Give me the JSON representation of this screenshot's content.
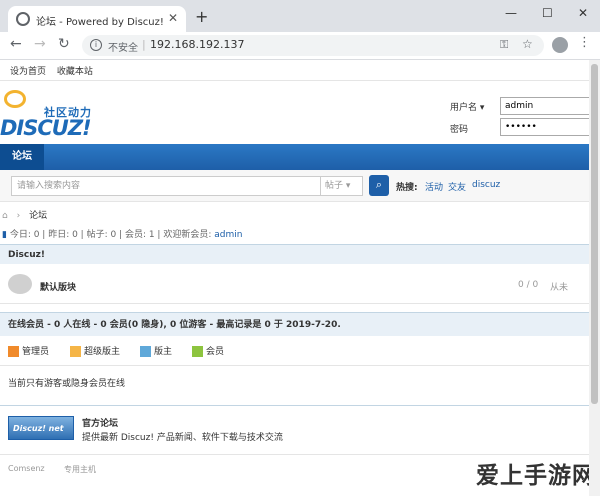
{
  "browser": {
    "tab_title": "论坛 - Powered by Discuz!",
    "tab_close": "✕",
    "new_tab": "+",
    "window_controls": {
      "minimize": "—",
      "maximize": "☐",
      "close": "✕"
    },
    "nav": {
      "back": "←",
      "forward": "→",
      "reload": "↻"
    },
    "omnibox": {
      "info_icon": "i",
      "insecure": "不安全",
      "separator": "|",
      "url": "192.168.192.137"
    },
    "key_icon": "⚿",
    "star_icon": "☆",
    "menu_icon": "⋮"
  },
  "topnav": {
    "items": [
      "设为首页",
      "收藏本站"
    ]
  },
  "logo": {
    "sub": "社区动力",
    "main": "DISCUZ!"
  },
  "login": {
    "username_label": "用户名 ▾",
    "username_value": "admin",
    "password_label": "密码",
    "password_value": "••••••"
  },
  "mainnav": {
    "active": "论坛"
  },
  "search": {
    "placeholder": "请输入搜索内容",
    "select": "帖子 ▾",
    "button_icon": "⌕",
    "hot_label": "热搜:",
    "hot_links": [
      "活动",
      "交友",
      "discuz"
    ]
  },
  "breadcrumb": {
    "home_icon": "⌂",
    "sep": "›",
    "current": "论坛"
  },
  "stats": {
    "icon": "▮",
    "text": "今日: 0 | 昨日: 0 | 帖子: 0 | 会员: 1 | 欢迎新会员: ",
    "new_member": "admin"
  },
  "category": {
    "title": "Discuz!"
  },
  "forum": {
    "name": "默认版块",
    "count": "0 / 0",
    "last": "从未"
  },
  "online": {
    "title": "在线会员 - 0 人在线 - 0 会员(0 隐身), 0 位游客 - 最高记录是 0 于 2019-7-20.",
    "legend": [
      {
        "label": "管理员",
        "color": "#f08a2b"
      },
      {
        "label": "超级版主",
        "color": "#f5b547"
      },
      {
        "label": "版主",
        "color": "#5fa8d9"
      },
      {
        "label": "会员",
        "color": "#8dc43f"
      }
    ],
    "note": "当前只有游客或隐身会员在线"
  },
  "official": {
    "logo_text": "Discuz! net",
    "title": "官方论坛",
    "desc": "提供最新 Discuz! 产品新闻、软件下载与技术交流"
  },
  "footer": {
    "links": [
      "Comsenz",
      "专用主机"
    ]
  },
  "watermark": "爱上手游网"
}
